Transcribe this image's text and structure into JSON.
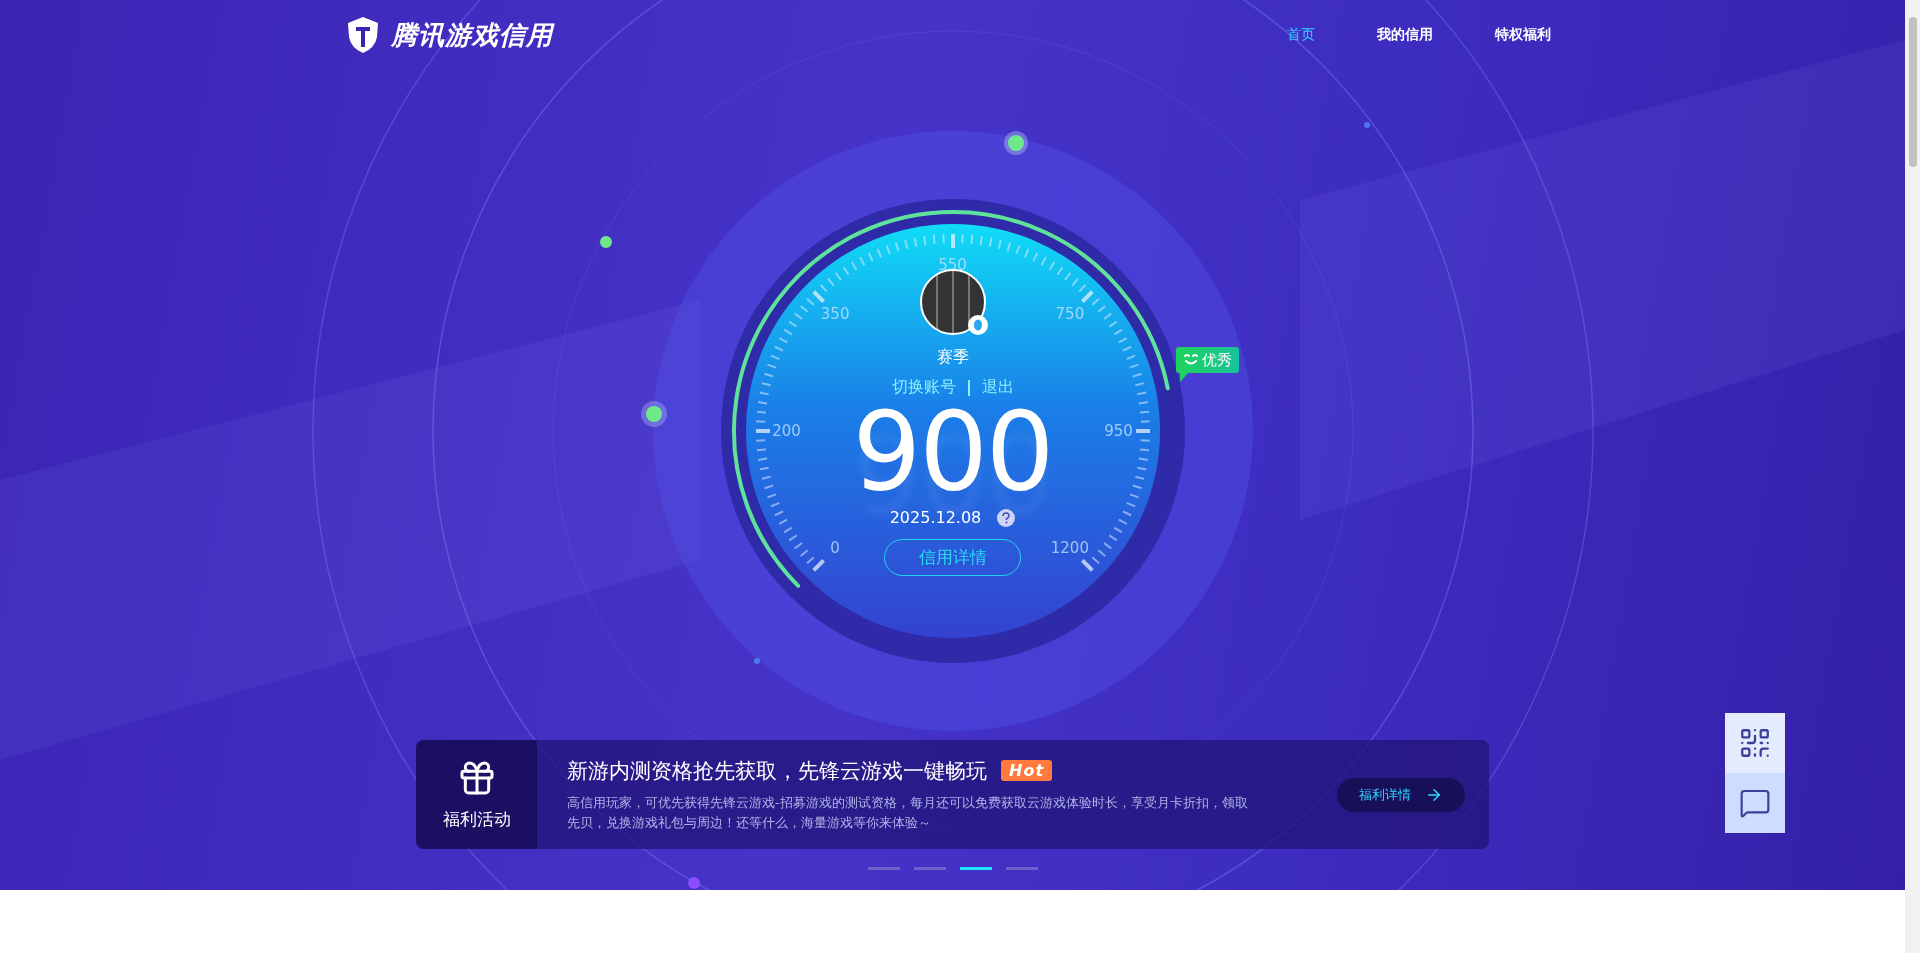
{
  "header": {
    "logo_text": "腾讯游戏信用",
    "nav": [
      {
        "label": "首页",
        "selected": true
      },
      {
        "label": "我的信用",
        "selected": false
      },
      {
        "label": "特权福利",
        "selected": false
      }
    ]
  },
  "gauge": {
    "scale_labels": [
      "0",
      "200",
      "350",
      "550",
      "750",
      "950",
      "1200"
    ],
    "rating": "优秀",
    "user_name": "赛季",
    "account_links": [
      "切换账号",
      "退出"
    ],
    "score": "900",
    "date": "2025.12.08",
    "details_button": "信用详情"
  },
  "banner": {
    "category": "福利活动",
    "title": "新游内测资格抢先获取，先锋云游戏一键畅玩",
    "tag": "Hot",
    "description": "高信用玩家，可优先获得先锋云游戏-招募游戏的测试资格，每月还可以免费获取云游戏体验时长，享受月卡折扣，领取先贝，兑换游戏礼包与周边！还等什么，海量游戏等你来体验～",
    "action": "福利详情"
  },
  "carousel": [
    {
      "selected": false
    },
    {
      "selected": false
    },
    {
      "selected": true
    },
    {
      "selected": false
    }
  ]
}
